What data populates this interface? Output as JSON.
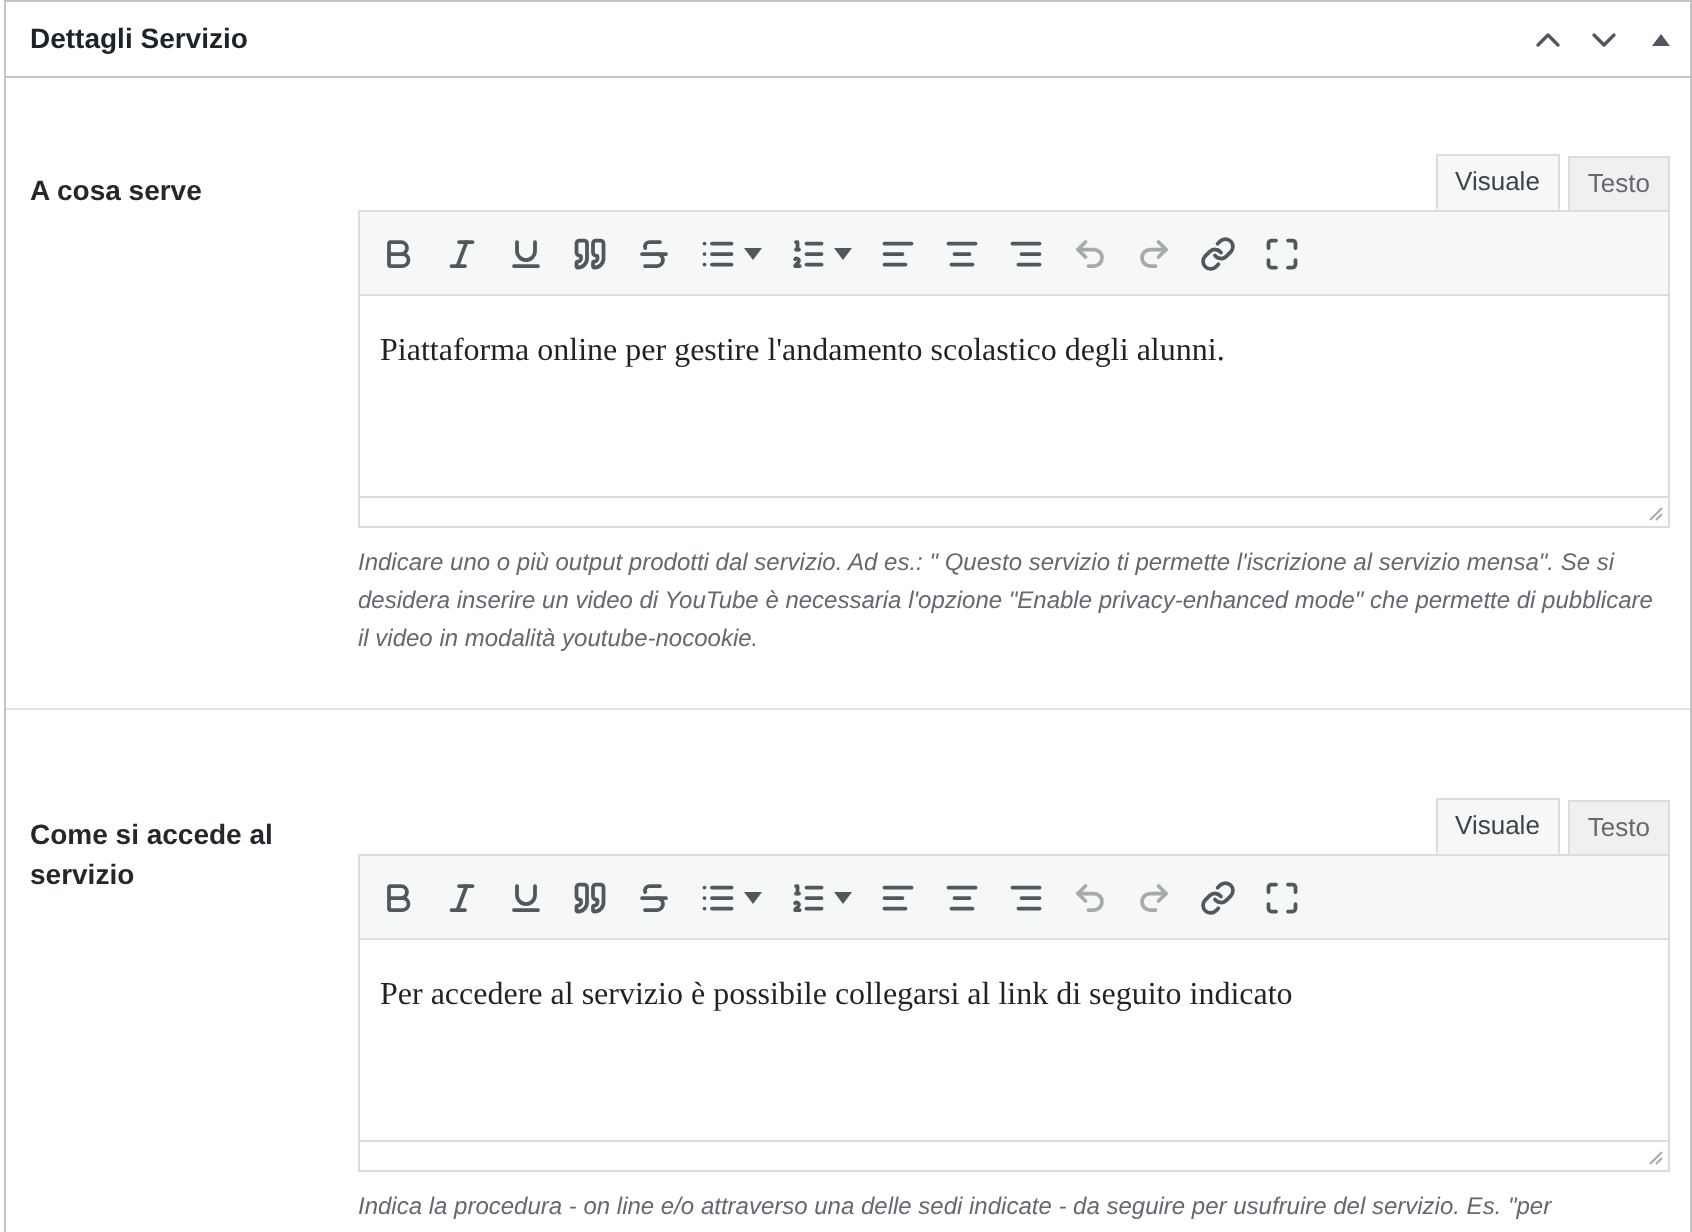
{
  "panel": {
    "title": "Dettagli Servizio"
  },
  "sections": [
    {
      "label": "A cosa serve",
      "tabs": [
        {
          "label": "Visuale",
          "selected": true
        },
        {
          "label": "Testo",
          "selected": false
        }
      ],
      "toolbar": [
        {
          "kind": "bold",
          "disabled": false
        },
        {
          "kind": "italic",
          "disabled": false
        },
        {
          "kind": "underline",
          "disabled": false
        },
        {
          "kind": "quote",
          "disabled": false
        },
        {
          "kind": "strike",
          "disabled": false
        },
        {
          "kind": "bullets",
          "disabled": false
        },
        {
          "kind": "numbers",
          "disabled": false
        },
        {
          "kind": "align-left",
          "disabled": false
        },
        {
          "kind": "align-center",
          "disabled": false
        },
        {
          "kind": "align-right",
          "disabled": false
        },
        {
          "kind": "undo",
          "disabled": true
        },
        {
          "kind": "redo",
          "disabled": true
        },
        {
          "kind": "link",
          "disabled": false
        },
        {
          "kind": "fullscreen",
          "disabled": false
        }
      ],
      "content": "Piattaforma online per gestire l'andamento scolastico degli alunni.",
      "help": "Indicare uno o più output prodotti dal servizio. Ad es.: \" Questo servizio ti permette l'iscrizione al servizio mensa\". Se si desidera inserire un video di YouTube è necessaria l'opzione \"Enable privacy-enhanced mode\" che permette di pubblicare il video in modalità youtube-nocookie."
    },
    {
      "label": "Come si accede al servizio",
      "tabs": [
        {
          "label": "Visuale",
          "selected": true
        },
        {
          "label": "Testo",
          "selected": false
        }
      ],
      "toolbar": [
        {
          "kind": "bold",
          "disabled": false
        },
        {
          "kind": "italic",
          "disabled": false
        },
        {
          "kind": "underline",
          "disabled": false
        },
        {
          "kind": "quote",
          "disabled": false
        },
        {
          "kind": "strike",
          "disabled": false
        },
        {
          "kind": "bullets",
          "disabled": false
        },
        {
          "kind": "numbers",
          "disabled": false
        },
        {
          "kind": "align-left",
          "disabled": false
        },
        {
          "kind": "align-center",
          "disabled": false
        },
        {
          "kind": "align-right",
          "disabled": false
        },
        {
          "kind": "undo",
          "disabled": true
        },
        {
          "kind": "redo",
          "disabled": true
        },
        {
          "kind": "link",
          "disabled": false
        },
        {
          "kind": "fullscreen",
          "disabled": false
        }
      ],
      "content": "Per accedere al servizio è possibile collegarsi al link di seguito indicato",
      "help": "Indica la procedura - on line e/o attraverso una delle sedi indicate - da seguire per usufruire del servizio. Es. \"per"
    }
  ]
}
